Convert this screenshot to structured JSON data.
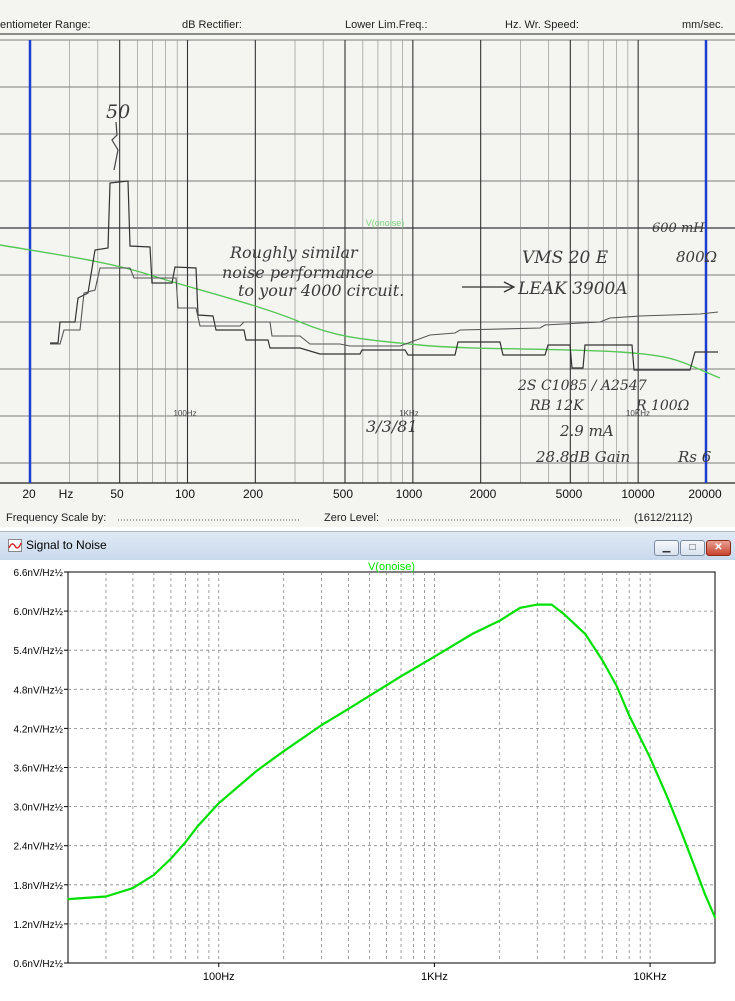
{
  "scan": {
    "header": [
      "entiometer Range:",
      "dB Rectifier:",
      "Lower Lim.Freq.:",
      "Hz. Wr. Speed:",
      "mm/sec."
    ],
    "footer": {
      "freq_scale": "Frequency Scale by:",
      "zero_level": "Zero Level:",
      "ref_code": "(1612/2112)"
    },
    "x_ticks": [
      "20",
      "Hz",
      "50",
      "100",
      "200",
      "500",
      "1000",
      "2000",
      "5000",
      "10000",
      "20000"
    ],
    "printed_freq_marks": [
      "100Hz",
      "1KHz",
      "10KHz"
    ],
    "overlay_label": "V(onoise)",
    "handwriting": {
      "marker": "50",
      "note": [
        "Roughly similar",
        "noise performance",
        "to your 4000 circuit."
      ],
      "arrow_to": "LEAK 3900A",
      "label_vms": "VMS 20 E",
      "impedance_1": "800Ω",
      "impedance_2": "600 mH",
      "transistors": "2S C1085 / A2547",
      "rb": "RB 12K",
      "r": "R 100Ω",
      "date": "3/3/81",
      "current": "2.9 mA",
      "gain": "28.8dB Gain",
      "rs": "Rs 6"
    }
  },
  "window": {
    "title": "Signal to Noise",
    "buttons": {
      "minimize": "▁",
      "maximize": "□",
      "close": "✕"
    }
  },
  "chart_data": {
    "type": "line",
    "title": "V(onoise)",
    "xscale": "log",
    "xlim": [
      20,
      20000
    ],
    "ylim": [
      0.6,
      6.6
    ],
    "x_tick_labels": [
      "100Hz",
      "1KHz",
      "10KHz"
    ],
    "y_tick_labels": [
      "6.6nV/Hz½",
      "6.0nV/Hz½",
      "5.4nV/Hz½",
      "4.8nV/Hz½",
      "4.2nV/Hz½",
      "3.6nV/Hz½",
      "3.0nV/Hz½",
      "2.4nV/Hz½",
      "1.8nV/Hz½",
      "1.2nV/Hz½",
      "0.6nV/Hz½"
    ],
    "grid": true,
    "series": [
      {
        "name": "V(onoise)",
        "color": "#00e000",
        "x": [
          20,
          30,
          40,
          50,
          60,
          70,
          80,
          100,
          150,
          200,
          300,
          400,
          500,
          700,
          1000,
          1500,
          2000,
          2500,
          3000,
          3500,
          4000,
          5000,
          6000,
          7000,
          8000,
          10000,
          12000,
          14000,
          16000,
          18000,
          20000
        ],
        "y": [
          1.58,
          1.62,
          1.75,
          1.95,
          2.2,
          2.45,
          2.7,
          3.05,
          3.55,
          3.85,
          4.25,
          4.5,
          4.7,
          5.0,
          5.3,
          5.65,
          5.85,
          6.05,
          6.1,
          6.1,
          5.95,
          5.65,
          5.25,
          4.85,
          4.4,
          3.75,
          3.15,
          2.6,
          2.1,
          1.65,
          1.3
        ]
      }
    ]
  }
}
